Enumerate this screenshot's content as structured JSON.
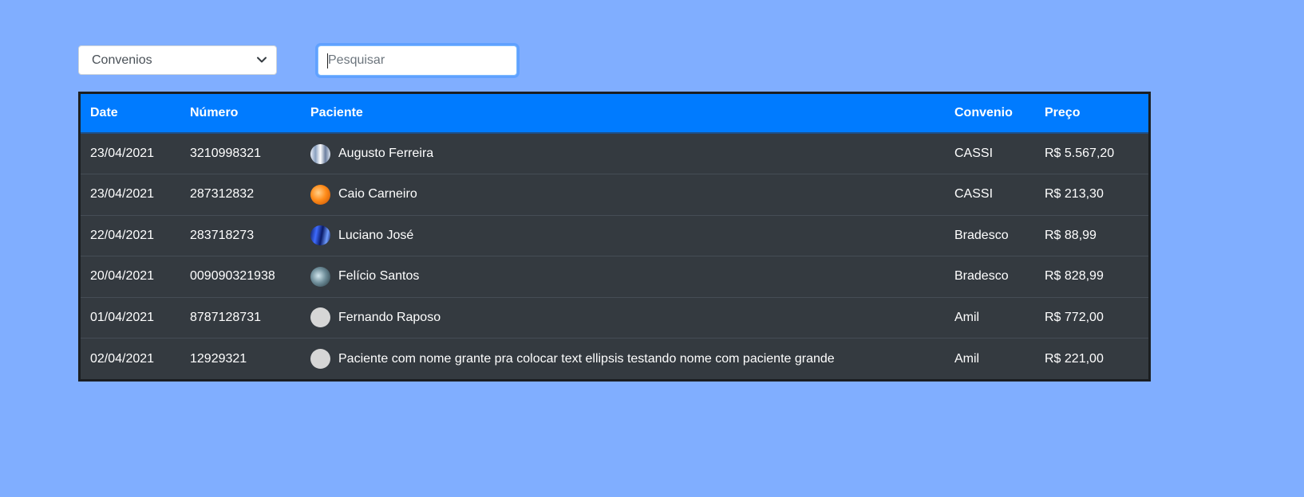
{
  "filters": {
    "select_value": "Convenios",
    "search_placeholder": "Pesquisar"
  },
  "table": {
    "headers": {
      "date": "Date",
      "numero": "Número",
      "paciente": "Paciente",
      "convenio": "Convenio",
      "preco": "Preço"
    },
    "rows": [
      {
        "date": "23/04/2021",
        "numero": "3210998321",
        "paciente": "Augusto Ferreira",
        "convenio": "CASSI",
        "preco": "R$ 5.567,20"
      },
      {
        "date": "23/04/2021",
        "numero": "287312832",
        "paciente": "Caio Carneiro",
        "convenio": "CASSI",
        "preco": "R$ 213,30"
      },
      {
        "date": "22/04/2021",
        "numero": "283718273",
        "paciente": "Luciano José",
        "convenio": "Bradesco",
        "preco": "R$ 88,99"
      },
      {
        "date": "20/04/2021",
        "numero": "009090321938",
        "paciente": "Felício Santos",
        "convenio": "Bradesco",
        "preco": "R$ 828,99"
      },
      {
        "date": "01/04/2021",
        "numero": "8787128731",
        "paciente": "Fernando Raposo",
        "convenio": "Amil",
        "preco": "R$ 772,00"
      },
      {
        "date": "02/04/2021",
        "numero": "12929321",
        "paciente": "Paciente com nome grante pra colocar text ellipsis testando nome com paciente grande",
        "convenio": "Amil",
        "preco": "R$ 221,00"
      }
    ]
  },
  "colors": {
    "page_background": "#80aeff",
    "header_background": "#007bff",
    "table_background": "#343a40"
  }
}
